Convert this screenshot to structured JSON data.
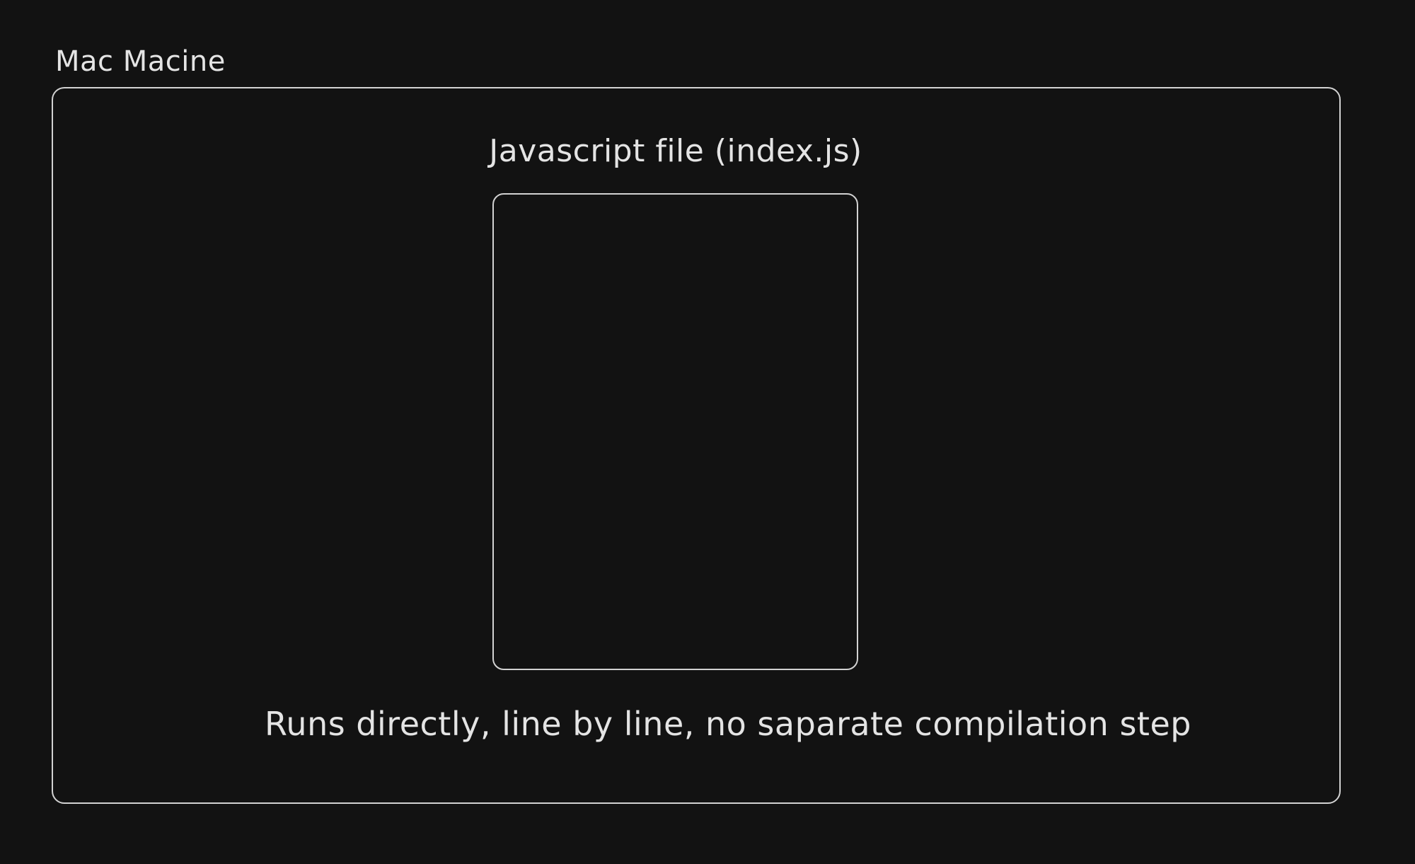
{
  "diagram": {
    "machine": {
      "title": "Mac Macine"
    },
    "file": {
      "title": "Javascript file (index.js)"
    },
    "caption": "Runs directly, line by line, no saparate compilation step"
  }
}
